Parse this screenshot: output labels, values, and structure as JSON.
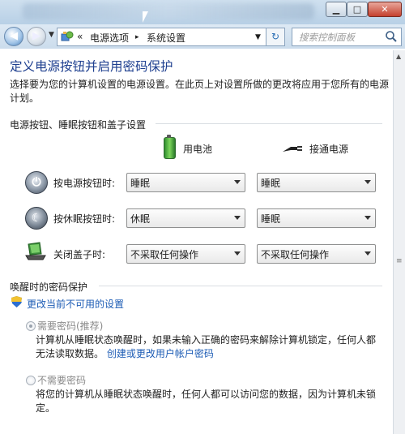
{
  "window": {
    "title_bar_blurred": true,
    "controls": {
      "minimize": "▁",
      "maximize": "□",
      "close": "✕"
    }
  },
  "address_bar": {
    "overflow": "«",
    "segments": [
      "电源选项",
      "系统设置"
    ],
    "separator": "▸",
    "refresh": "↻",
    "search_placeholder": "搜索控制面板"
  },
  "page": {
    "title": "定义电源按钮并启用密码保护",
    "description": "选择要为您的计算机设置的电源设置。在此页上对设置所做的更改将应用于您所有的电源计划。",
    "section_buttons": "电源按钮、睡眠按钮和盖子设置",
    "col_battery": "用电池",
    "col_plugged": "接通电源",
    "rows": [
      {
        "label": "按电源按钮时:",
        "battery": "睡眠",
        "plugged": "睡眠"
      },
      {
        "label": "按休眠按钮时:",
        "battery": "休眠",
        "plugged": "睡眠"
      },
      {
        "label": "关闭盖子时:",
        "battery": "不采取任何操作",
        "plugged": "不采取任何操作"
      }
    ],
    "section_password": "唤醒时的密码保护",
    "change_link": "更改当前不可用的设置",
    "opt_require": {
      "label": "需要密码(推荐)",
      "text": "计算机从睡眠状态唤醒时，如果未输入正确的密码来解除计算机锁定，任何人都无法读取数据。",
      "link": "创建或更改用户帐户密码"
    },
    "opt_norequire": {
      "label": "不需要密码",
      "text": "将您的计算机从睡眠状态唤醒时，任何人都可以访问您的数据，因为计算机未锁定。"
    }
  }
}
